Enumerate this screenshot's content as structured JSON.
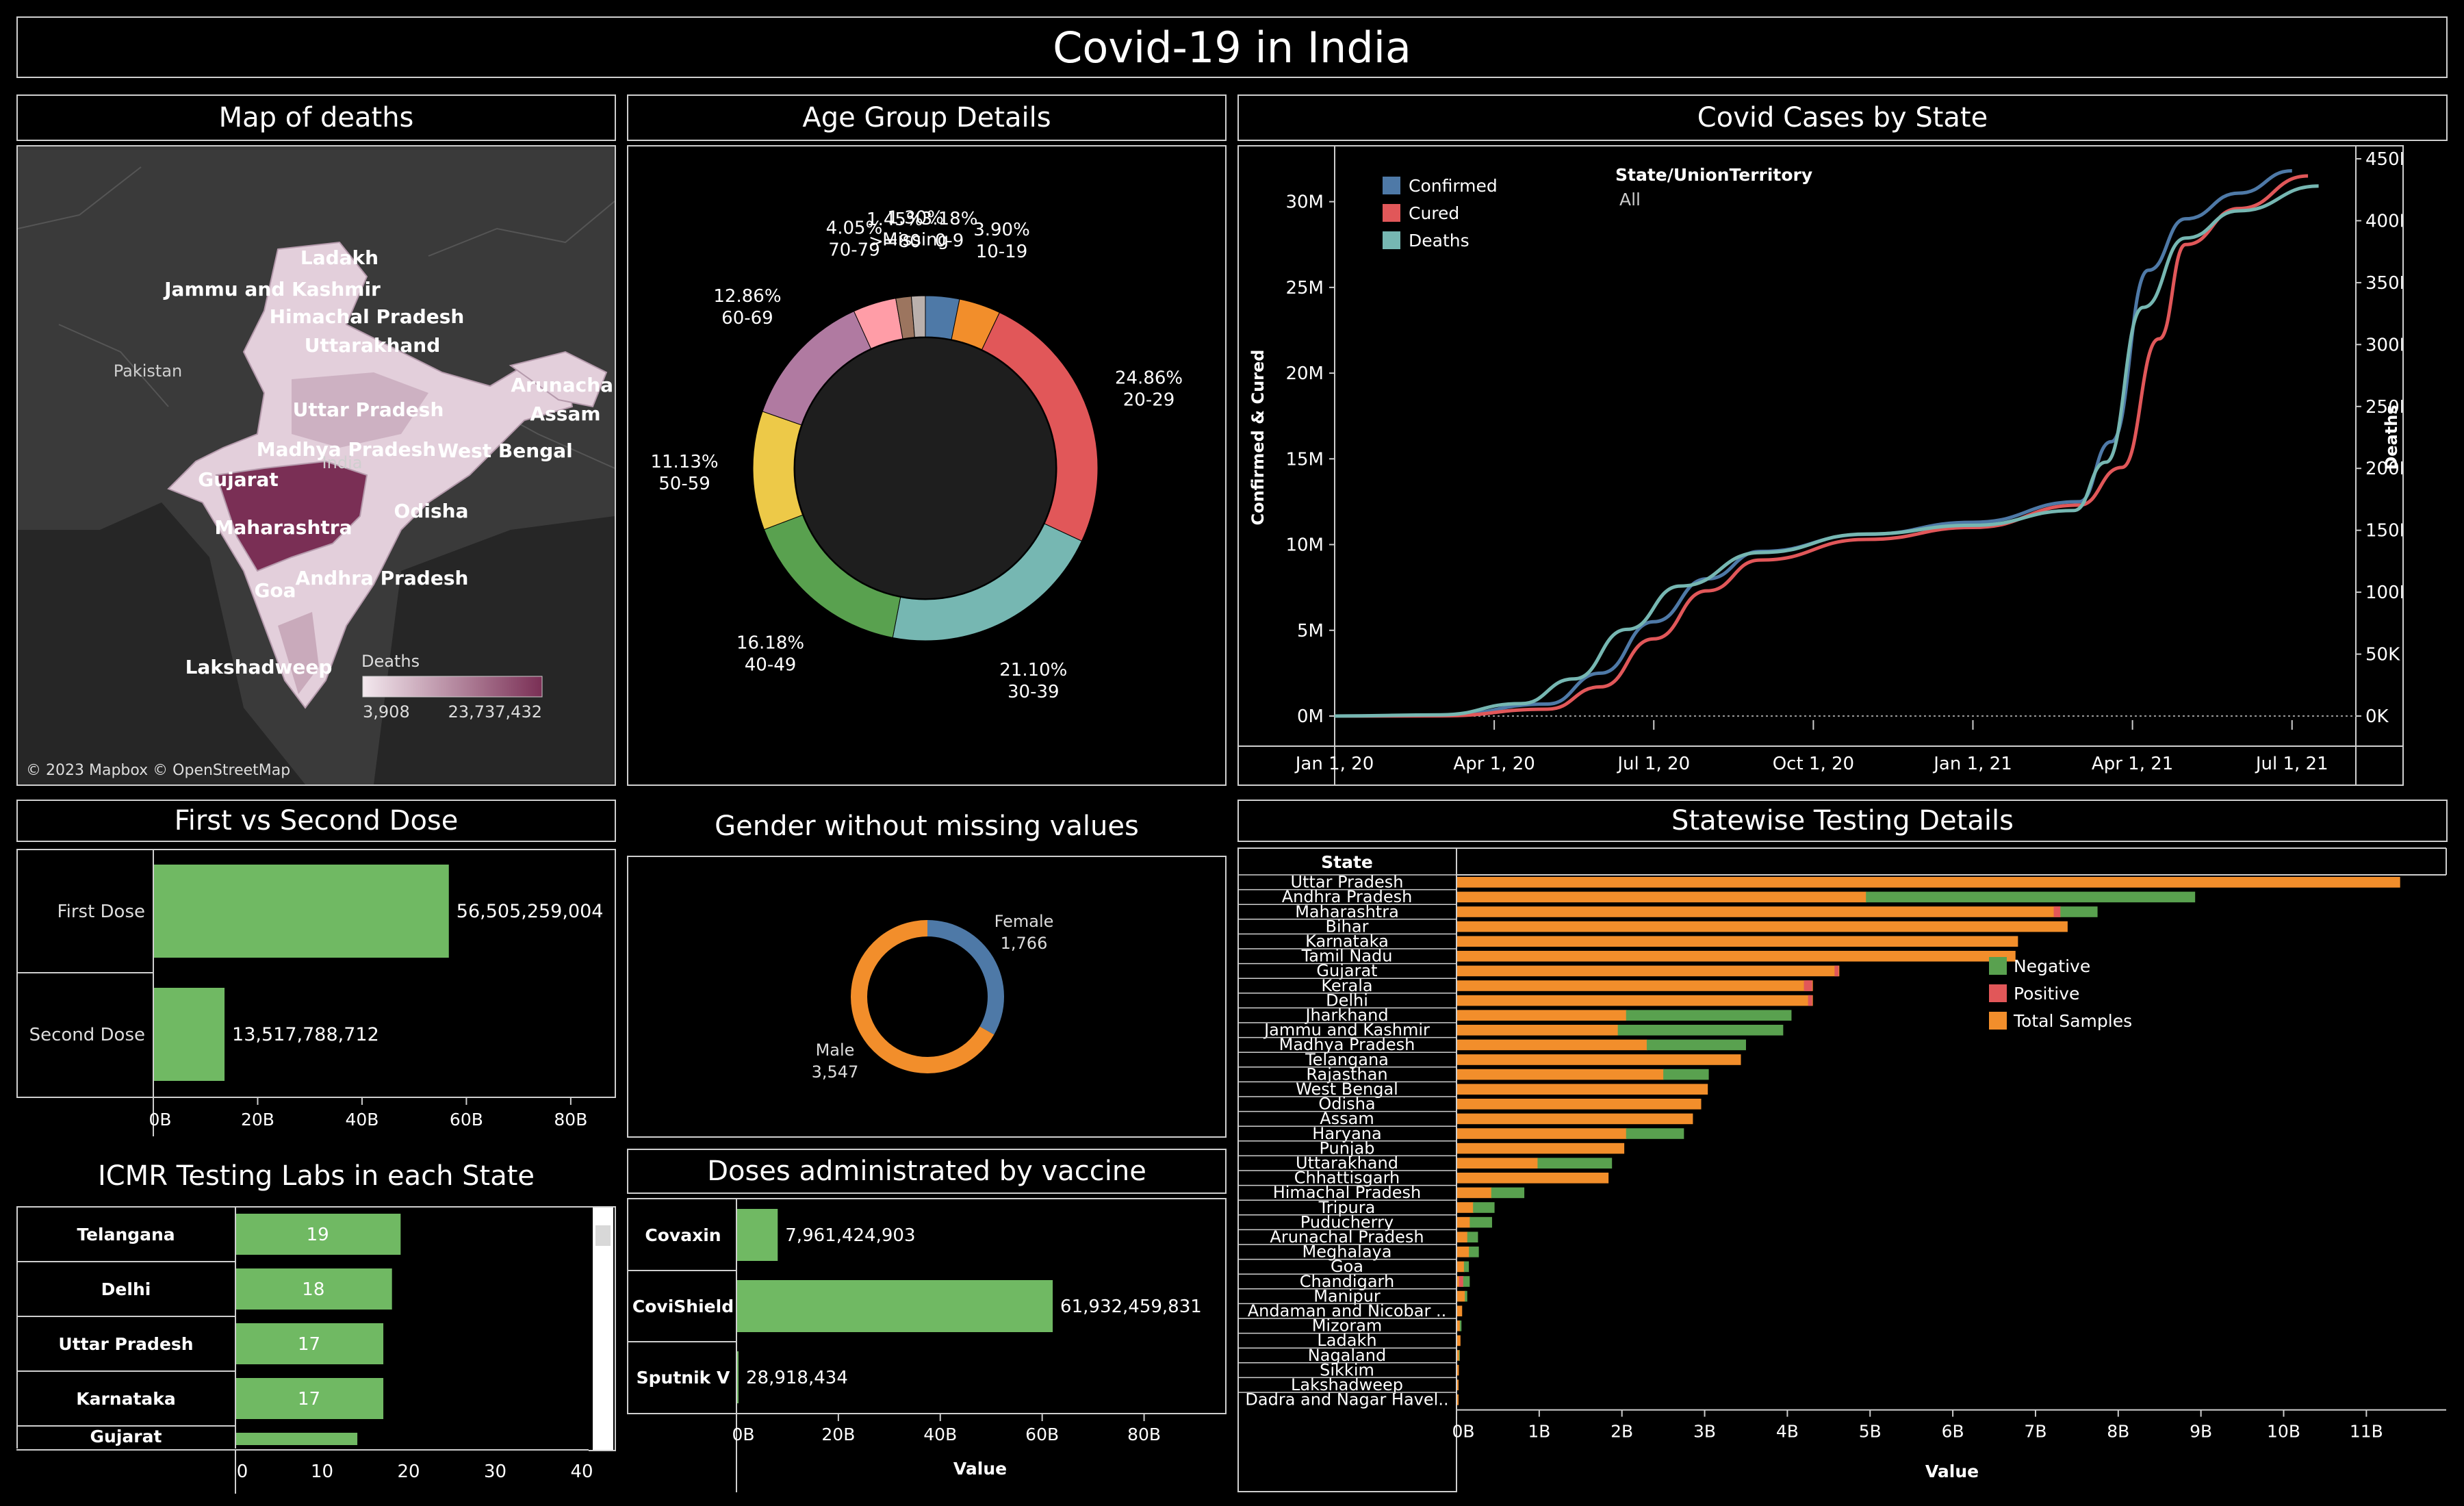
{
  "dashboard": {
    "title": "Covid-19 in India"
  },
  "colors": {
    "green": "#70b963",
    "orange": "#f28e2b",
    "blue": "#4e79a7",
    "red": "#e15759",
    "teal": "#76b7b2",
    "mapDark": "#7a2f55",
    "mapLight": "#ead8e2"
  },
  "map": {
    "title": "Map of deaths",
    "labels": [
      "Ladakh",
      "Jammu and Kashmir",
      "Himachal Pradesh",
      "Uttarakhand",
      "Pakistan",
      "Arunachal",
      "Assam",
      "Uttar Pradesh",
      "Madhya Pradesh",
      "India",
      "West Bengal",
      "Gujarat",
      "Odisha",
      "Maharashtra",
      "Goa",
      "Andhra Pradesh",
      "Lakshadweep"
    ],
    "legend": {
      "title": "Deaths",
      "min": "3,908",
      "max": "23,737,432"
    },
    "credit": "© 2023 Mapbox © OpenStreetMap"
  },
  "age": {
    "title": "Age Group Details",
    "chart_data": {
      "type": "pie",
      "slices": [
        {
          "label": "0-9",
          "pct": "3.18%",
          "value": 3.18,
          "color": "#4e79a7"
        },
        {
          "label": "10-19",
          "pct": "3.90%",
          "value": 3.9,
          "color": "#f28e2b"
        },
        {
          "label": "20-29",
          "pct": "24.86%",
          "value": 24.86,
          "color": "#e15759"
        },
        {
          "label": "30-39",
          "pct": "21.10%",
          "value": 21.1,
          "color": "#76b7b2"
        },
        {
          "label": "40-49",
          "pct": "16.18%",
          "value": 16.18,
          "color": "#59a14f"
        },
        {
          "label": "50-59",
          "pct": "11.13%",
          "value": 11.13,
          "color": "#edc948"
        },
        {
          "label": "60-69",
          "pct": "12.86%",
          "value": 12.86,
          "color": "#b07aa1"
        },
        {
          "label": "70-79",
          "pct": "4.05%",
          "value": 4.05,
          "color": "#ff9da7"
        },
        {
          "label": ">=80",
          "pct": "1.45%",
          "value": 1.45,
          "color": "#9c755f"
        },
        {
          "label": "Missing",
          "pct": "1.30%",
          "value": 1.3,
          "color": "#bab0ac"
        }
      ]
    }
  },
  "cases": {
    "title": "Covid Cases by State",
    "filter": {
      "label": "State/UnionTerritory",
      "value": "All"
    },
    "chart_data": {
      "type": "line",
      "legend": [
        "Confirmed",
        "Cured",
        "Deaths"
      ],
      "ylabel": "Confirmed & Cured",
      "y2label": "Deaths",
      "yticks": [
        "0M",
        "5M",
        "10M",
        "15M",
        "20M",
        "25M",
        "30M"
      ],
      "y2ticks": [
        "0K",
        "50K",
        "100K",
        "150K",
        "200K",
        "250K",
        "300K",
        "350K",
        "400K",
        "450K"
      ],
      "xticks": [
        "Jan 1, 20",
        "Apr 1, 20",
        "Jul 1, 20",
        "Oct 1, 20",
        "Jan 1, 21",
        "Apr 1, 21",
        "Jul 1, 21"
      ],
      "ylim": [
        0,
        32.5
      ],
      "y2lim": [
        0,
        450
      ],
      "series": [
        {
          "name": "Confirmed",
          "axis": "left",
          "points": [
            [
              0,
              0
            ],
            [
              2,
              0.02
            ],
            [
              4,
              0.7
            ],
            [
              5,
              2.5
            ],
            [
              6,
              5.5
            ],
            [
              7,
              8
            ],
            [
              8,
              9.6
            ],
            [
              10,
              10.6
            ],
            [
              12,
              11.3
            ],
            [
              14,
              12.5
            ],
            [
              14.6,
              16
            ],
            [
              15.3,
              26
            ],
            [
              16,
              29
            ],
            [
              17,
              30.5
            ],
            [
              18,
              31.8
            ]
          ]
        },
        {
          "name": "Cured",
          "axis": "left",
          "points": [
            [
              0,
              0
            ],
            [
              2,
              0.01
            ],
            [
              4,
              0.4
            ],
            [
              5,
              1.7
            ],
            [
              6,
              4.5
            ],
            [
              7,
              7.3
            ],
            [
              8,
              9.1
            ],
            [
              10,
              10.3
            ],
            [
              12,
              11
            ],
            [
              14,
              12.3
            ],
            [
              14.8,
              14.5
            ],
            [
              15.5,
              22
            ],
            [
              16,
              27.5
            ],
            [
              17,
              29.6
            ],
            [
              18.3,
              31.5
            ]
          ]
        },
        {
          "name": "Deaths",
          "axis": "right",
          "points": [
            [
              0,
              0
            ],
            [
              2,
              1
            ],
            [
              3.5,
              10
            ],
            [
              4.5,
              30
            ],
            [
              5.5,
              70
            ],
            [
              6.5,
              105
            ],
            [
              8,
              132
            ],
            [
              10,
              147
            ],
            [
              12,
              154
            ],
            [
              13.9,
              166
            ],
            [
              14.5,
              205
            ],
            [
              15.2,
              330
            ],
            [
              16,
              386
            ],
            [
              17,
              408
            ],
            [
              18.5,
              428
            ]
          ]
        }
      ]
    }
  },
  "dose": {
    "title": "First vs Second Dose",
    "chart_data": {
      "type": "bar",
      "categories": [
        "First Dose",
        "Second Dose"
      ],
      "values": [
        56505259004,
        13517788712
      ],
      "labels": [
        "56,505,259,004",
        "13,517,788,712"
      ],
      "xticks": [
        "0B",
        "20B",
        "40B",
        "60B",
        "80B"
      ],
      "xlim": [
        0,
        85000000000
      ]
    }
  },
  "gender": {
    "title": "Gender without missing values",
    "chart_data": {
      "type": "pie",
      "slices": [
        {
          "label": "Female",
          "value": 1766,
          "text": "1,766",
          "color": "#4e79a7"
        },
        {
          "label": "Male",
          "value": 3547,
          "text": "3,547",
          "color": "#f28e2b"
        }
      ]
    }
  },
  "labs": {
    "title": "ICMR Testing Labs in each State",
    "chart_data": {
      "type": "bar",
      "categories": [
        "Telangana",
        "Delhi",
        "Uttar Pradesh",
        "Karnataka",
        "Gujarat"
      ],
      "values": [
        19,
        18,
        17,
        17,
        14
      ],
      "labels": [
        "19",
        "18",
        "17",
        "17",
        ""
      ],
      "xticks": [
        "0",
        "10",
        "20",
        "30",
        "40"
      ],
      "xlim": [
        0,
        40
      ]
    }
  },
  "vaccine": {
    "title": "Doses administrated by vaccine",
    "chart_data": {
      "type": "bar",
      "categories": [
        "Covaxin",
        "CoviShield",
        "Sputnik V"
      ],
      "values": [
        7961424903,
        61932459831,
        28918434
      ],
      "labels": [
        "7,961,424,903",
        "61,932,459,831",
        "28,918,434"
      ],
      "xticks": [
        "0B",
        "20B",
        "40B",
        "60B",
        "80B"
      ],
      "xlim": [
        0,
        90000000000
      ],
      "xlabel": "Value"
    }
  },
  "testing": {
    "title": "Statewise Testing Details",
    "col_header": "State",
    "legend": [
      "Negative",
      "Positive",
      "Total Samples"
    ],
    "chart_data": {
      "type": "bar",
      "xlabel": "Value",
      "xticks": [
        "0B",
        "1B",
        "2B",
        "3B",
        "4B",
        "5B",
        "6B",
        "7B",
        "8B",
        "9B",
        "10B",
        "11B"
      ],
      "xlim": [
        0,
        11.75
      ],
      "states": [
        "Uttar Pradesh",
        "Andhra Pradesh",
        "Maharashtra",
        "Bihar",
        "Karnataka",
        "Tamil Nadu",
        "Gujarat",
        "Kerala",
        "Delhi",
        "Jharkhand",
        "Jammu and Kashmir",
        "Madhya Pradesh",
        "Telangana",
        "Rajasthan",
        "West Bengal",
        "Odisha",
        "Assam",
        "Haryana",
        "Punjab",
        "Uttarakhand",
        "Chhattisgarh",
        "Himachal Pradesh",
        "Tripura",
        "Puducherry",
        "Arunachal Pradesh",
        "Meghalaya",
        "Goa",
        "Chandigarh",
        "Manipur",
        "Andaman and Nicobar ..",
        "Mizoram",
        "Ladakh",
        "Nagaland",
        "Sikkim",
        "Lakshadweep",
        "Dadra and Nagar Havel.."
      ],
      "total": [
        11.4,
        4.95,
        7.3,
        7.38,
        6.78,
        6.75,
        4.62,
        4.3,
        4.3,
        2.05,
        1.95,
        2.3,
        3.43,
        2.5,
        3.03,
        2.95,
        2.85,
        2.05,
        2.02,
        0.98,
        1.83,
        0.42,
        0.2,
        0.16,
        0.13,
        0.15,
        0.09,
        0.08,
        0.1,
        0.06,
        0.04,
        0.04,
        0.03,
        0.02,
        0.01,
        0.01
      ],
      "negative": [
        0,
        3.98,
        0.45,
        0,
        0,
        0,
        0,
        0,
        0,
        2.0,
        2.0,
        1.2,
        0,
        0.55,
        0,
        0,
        0,
        0.7,
        0,
        0.9,
        0,
        0.4,
        0.26,
        0.27,
        0.13,
        0.12,
        0.06,
        0.08,
        0.03,
        0,
        0.02,
        0,
        0.01,
        0,
        0,
        0
      ],
      "positive": [
        0,
        0,
        0.08,
        0,
        0,
        0,
        0.04,
        0.1,
        0.04,
        0,
        0,
        0,
        0,
        0,
        0,
        0,
        0,
        0,
        0,
        0,
        0,
        0,
        0,
        0,
        0,
        0,
        0,
        0.02,
        0,
        0,
        0,
        0,
        0,
        0,
        0,
        0
      ]
    }
  }
}
